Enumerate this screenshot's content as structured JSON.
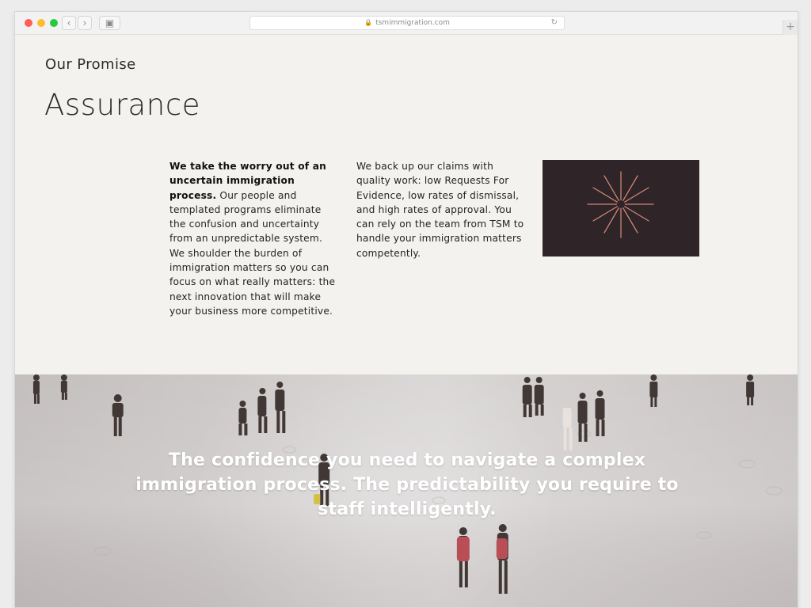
{
  "browser": {
    "url": "tsmimmigration.com",
    "controls": {
      "back": "‹",
      "forward": "›",
      "sidebar": "▣",
      "reload": "↻",
      "new_tab": "+"
    }
  },
  "promise": {
    "kicker": "Our Promise",
    "title": "Assurance",
    "left_lead": "We take the worry out of an uncertain immigration process.",
    "left_body": "Our people and templated programs eliminate the confusion and uncertainty from an unpredictable system. We shoulder the burden of immigration matters so you can focus on what really matters: the next innovation that will make your business more competitive.",
    "right_body": "We back up our claims with quality work: low Requests For Evidence, low rates of dismissal, and high rates of approval. You can rely on the team from TSM to handle your immigration matters competently."
  },
  "hero": {
    "message": "The confidence you need to navigate a complex immigration process. The predictability you require to staff intelligently."
  },
  "colors": {
    "page_background": "#f4f2ee",
    "art_background": "#2f2528",
    "art_accent": "#df8f7e"
  },
  "icons": {
    "art": "sunburst-icon"
  }
}
